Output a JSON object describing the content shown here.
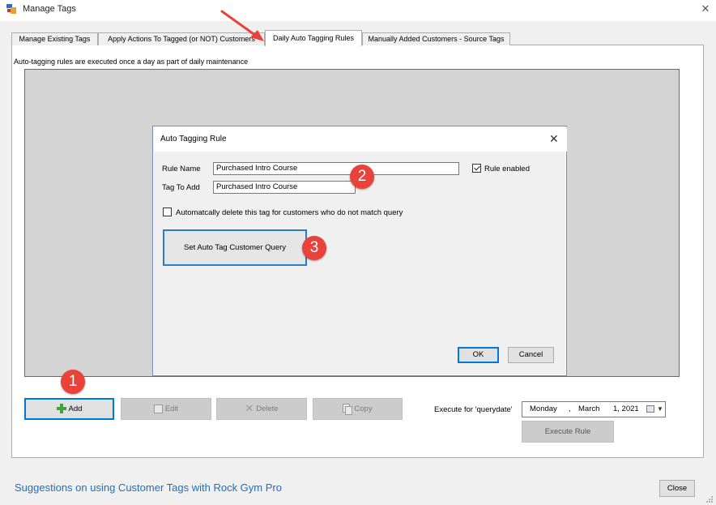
{
  "window": {
    "title": "Manage Tags"
  },
  "tabs": [
    {
      "label": "Manage Existing Tags"
    },
    {
      "label": "Apply Actions To Tagged (or NOT) Customers"
    },
    {
      "label": "Daily Auto Tagging Rules"
    },
    {
      "label": "Manually Added Customers - Source Tags"
    }
  ],
  "panel": {
    "note": "Auto-tagging rules are executed once a day as part of daily maintenance"
  },
  "dialog": {
    "title": "Auto Tagging Rule",
    "rule_name_label": "Rule Name",
    "rule_name_value": "Purchased Intro Course",
    "tag_to_add_label": "Tag To Add",
    "tag_to_add_value": "Purchased Intro Course",
    "rule_enabled_label": "Rule enabled",
    "rule_enabled": true,
    "auto_delete_label": "Automatcally delete this tag for customers who do not match query",
    "auto_delete": false,
    "query_button": "Set Auto Tag Customer Query",
    "ok": "OK",
    "cancel": "Cancel"
  },
  "toolbar": {
    "add": "Add",
    "edit": "Edit",
    "delete": "Delete",
    "copy": "Copy"
  },
  "execute": {
    "label": "Execute for 'querydate'",
    "date_day": "Monday",
    "date_sep1": ",",
    "date_month": "March",
    "date_daynum": "1, 2021",
    "button": "Execute Rule"
  },
  "footer": {
    "help_link": "Suggestions on using Customer Tags with Rock Gym Pro",
    "close": "Close"
  },
  "annotations": {
    "badge1": "1",
    "badge2": "2",
    "badge3": "3",
    "color": "#e8423a"
  },
  "icons": {
    "add": "plus-icon",
    "edit": "edit-icon",
    "delete": "x-icon",
    "copy": "copy-icon"
  }
}
